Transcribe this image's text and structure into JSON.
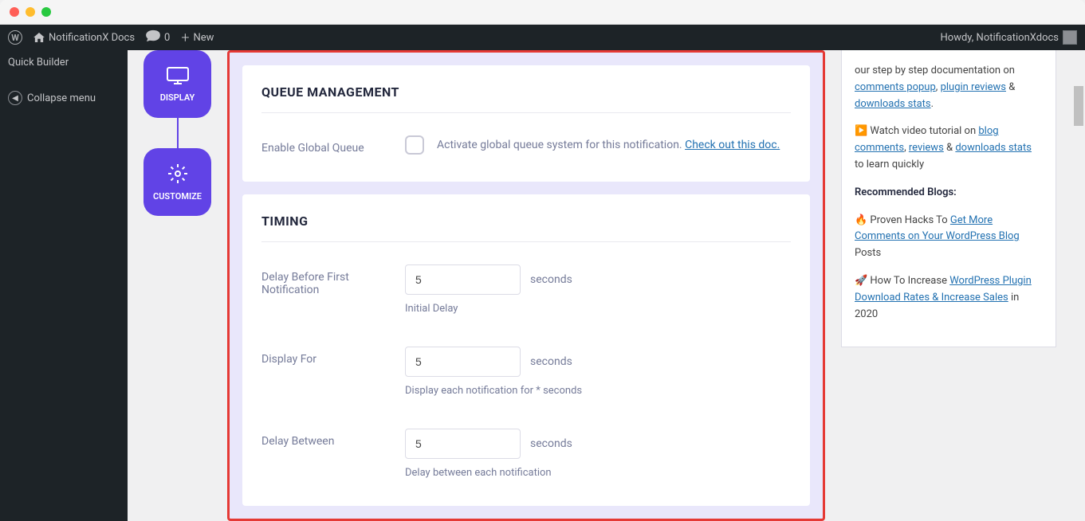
{
  "adminBar": {
    "siteName": "NotificationX Docs",
    "commentCount": "0",
    "newLabel": "New",
    "greeting": "Howdy, NotificationXdocs"
  },
  "sidebar": {
    "quickBuilder": "Quick Builder",
    "collapseMenu": "Collapse menu"
  },
  "steps": {
    "display": "DISPLAY",
    "customize": "CUSTOMIZE"
  },
  "queue": {
    "sectionTitle": "QUEUE MANAGEMENT",
    "enableLabel": "Enable Global Queue",
    "description": "Activate global queue system for this notification. ",
    "docLink": "Check out this doc."
  },
  "timing": {
    "sectionTitle": "TIMING",
    "delayBefore": {
      "label": "Delay Before First Notification",
      "value": "5",
      "unit": "seconds",
      "help": "Initial Delay"
    },
    "displayFor": {
      "label": "Display For",
      "value": "5",
      "unit": "seconds",
      "help": "Display each notification for * seconds"
    },
    "delayBetween": {
      "label": "Delay Between",
      "value": "5",
      "unit": "seconds",
      "help": "Delay between each notification"
    }
  },
  "rightSidebar": {
    "intro": "our step by step documentation on ",
    "link1": "comments popup",
    "sep1": ", ",
    "link2": "plugin reviews",
    "sep2": " & ",
    "link3": "downloads stats",
    "period": ".",
    "videoIntro": "▶️ Watch video tutorial on ",
    "link4": "blog comments",
    "sep3": ", ",
    "link5": "reviews",
    "sep4": " & ",
    "link6": "downloads stats",
    "videoOutro": " to learn quickly",
    "recommendedTitle": "Recommended Blogs:",
    "blog1Prefix": "🔥 Proven Hacks To ",
    "blog1Link": "Get More Comments on Your WordPress Blog",
    "blog1Suffix": " Posts",
    "blog2Prefix": "🚀 How To Increase ",
    "blog2Link": "WordPress Plugin Download Rates & Increase Sales",
    "blog2Suffix": " in 2020"
  }
}
